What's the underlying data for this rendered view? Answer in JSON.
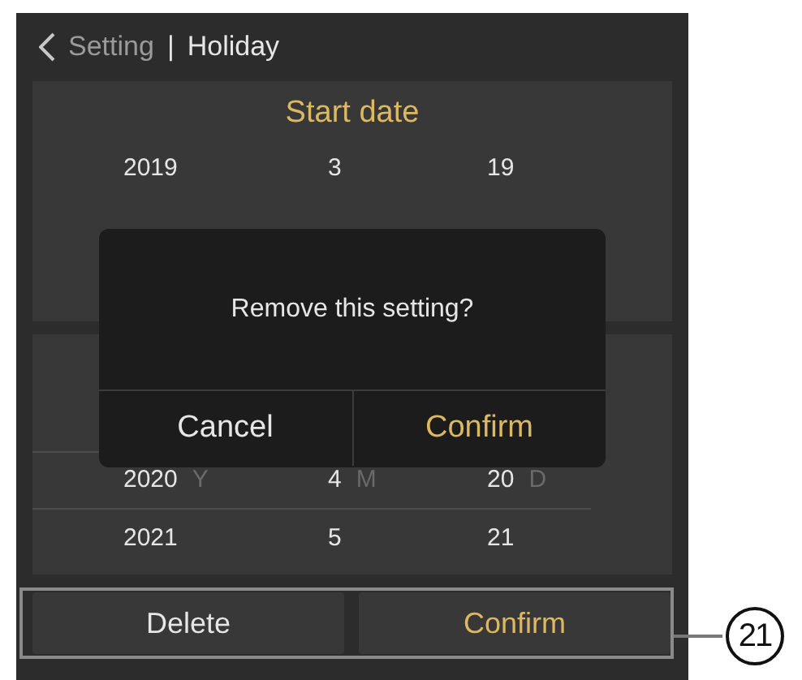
{
  "header": {
    "back": "Setting",
    "separator": "|",
    "title": "Holiday"
  },
  "start_date": {
    "title": "Start date",
    "rows": [
      {
        "selected": false,
        "cells": [
          {
            "value": "2019"
          },
          {
            "value": "3"
          },
          {
            "value": "19"
          }
        ]
      }
    ]
  },
  "end_date": {
    "rows": [
      {
        "selected": true,
        "cells": [
          {
            "value": "2020",
            "unit": "Y"
          },
          {
            "value": "4",
            "unit": "M"
          },
          {
            "value": "20",
            "unit": "D"
          }
        ]
      },
      {
        "selected": false,
        "cells": [
          {
            "value": "2021"
          },
          {
            "value": "5"
          },
          {
            "value": "21"
          }
        ]
      }
    ]
  },
  "buttons": [
    {
      "label": "Delete",
      "kind": "plain"
    },
    {
      "label": "Confirm",
      "kind": "accent"
    }
  ],
  "dialog": {
    "message": "Remove this setting?",
    "buttons": [
      {
        "label": "Cancel",
        "kind": "plain"
      },
      {
        "label": "Confirm",
        "kind": "accent"
      }
    ]
  },
  "callout": "21"
}
